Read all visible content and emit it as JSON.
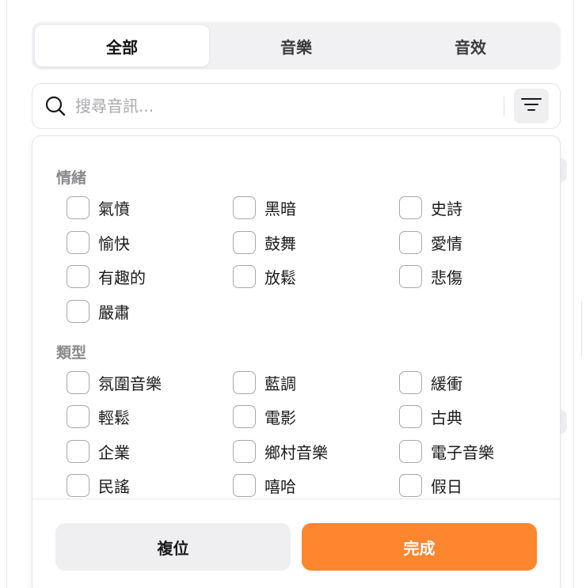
{
  "tabs": [
    {
      "label": "全部",
      "active": true
    },
    {
      "label": "音樂",
      "active": false
    },
    {
      "label": "音效",
      "active": false
    }
  ],
  "search": {
    "placeholder": "搜尋音訊...",
    "value": "",
    "icon": "search-icon",
    "filter_icon": "filter-lines-icon"
  },
  "filters": {
    "mood": {
      "title": "情緒",
      "options": [
        {
          "label": "氣憤",
          "checked": false
        },
        {
          "label": "黑暗",
          "checked": false
        },
        {
          "label": "史詩",
          "checked": false
        },
        {
          "label": "愉快",
          "checked": false
        },
        {
          "label": "鼓舞",
          "checked": false
        },
        {
          "label": "愛情",
          "checked": false
        },
        {
          "label": "有趣的",
          "checked": false
        },
        {
          "label": "放鬆",
          "checked": false
        },
        {
          "label": "悲傷",
          "checked": false
        },
        {
          "label": "嚴肅",
          "checked": false
        }
      ]
    },
    "genre": {
      "title": "類型",
      "options": [
        {
          "label": "氛圍音樂",
          "checked": false
        },
        {
          "label": "藍調",
          "checked": false
        },
        {
          "label": "緩衝",
          "checked": false
        },
        {
          "label": "輕鬆",
          "checked": false
        },
        {
          "label": "電影",
          "checked": false
        },
        {
          "label": "古典",
          "checked": false
        },
        {
          "label": "企業",
          "checked": false
        },
        {
          "label": "鄉村音樂",
          "checked": false
        },
        {
          "label": "電子音樂",
          "checked": false
        },
        {
          "label": "民謠",
          "checked": false
        },
        {
          "label": "嘻哈",
          "checked": false
        },
        {
          "label": "假日",
          "checked": false
        }
      ]
    }
  },
  "footer": {
    "reset_label": "複位",
    "done_label": "完成"
  },
  "colors": {
    "accent": "#fd862e",
    "tab_bg": "#f1f1f4",
    "section_title": "#8a8a8f",
    "checkbox_border": "#a8a8ae"
  }
}
